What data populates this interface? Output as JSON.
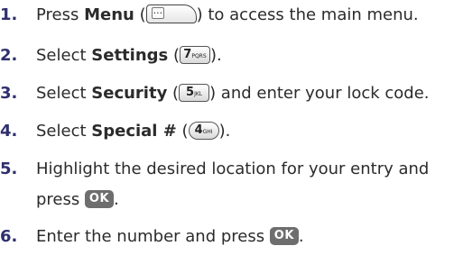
{
  "steps": [
    {
      "num": "1.",
      "pre": "Press ",
      "bold": "Menu",
      "mid": " (",
      "post": ") to access the main menu.",
      "key": {
        "type": "menu",
        "icon": "menu-key-icon",
        "glyph": "···"
      }
    },
    {
      "num": "2.",
      "pre": "Select ",
      "bold": "Settings",
      "mid": " (",
      "post": ").",
      "key": {
        "type": "num",
        "icon": "key-7pqrs-icon",
        "big": "7",
        "small": "PQRS"
      }
    },
    {
      "num": "3.",
      "pre": "Select ",
      "bold": "Security",
      "mid": " (",
      "post": ") and enter your lock code.",
      "key": {
        "type": "num",
        "icon": "key-5jkl-icon",
        "big": "5",
        "small": "JKL"
      }
    },
    {
      "num": "4.",
      "pre": "Select ",
      "bold": "Special #",
      "mid": " (",
      "post": ").",
      "key": {
        "type": "num-round",
        "icon": "key-4ghi-icon",
        "big": "4",
        "small": "GHI"
      }
    },
    {
      "num": "5.",
      "line1": "Highlight the desired location for your entry and",
      "line2_pre": "press ",
      "line2_post": ".",
      "key": {
        "type": "ok",
        "icon": "ok-key-icon",
        "label": "OK"
      }
    },
    {
      "num": "6.",
      "pre": "Enter the number and press ",
      "post": ".",
      "key": {
        "type": "ok",
        "icon": "ok-key-icon",
        "label": "OK"
      }
    }
  ],
  "colors": {
    "number": "#2f2f6e",
    "text": "#2b2b2b",
    "ok_key": "#6e6e6e"
  }
}
